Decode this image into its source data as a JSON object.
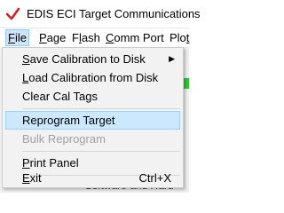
{
  "window": {
    "title": "EDIS ECI Target Communications",
    "icon": "checkmark-app-icon",
    "accent": "#d42020"
  },
  "menubar": {
    "file": {
      "pre": "",
      "u": "F",
      "post": "ile"
    },
    "page": {
      "pre": "",
      "u": "P",
      "post": "age"
    },
    "flash": {
      "pre": "F",
      "u": "l",
      "post": "ash"
    },
    "comm_port": {
      "pre": "",
      "u": "C",
      "post": "omm Port"
    },
    "plot": {
      "pre": "Plo",
      "u": "t",
      "post": ""
    }
  },
  "file_menu": {
    "save_cal": {
      "pre": "",
      "u": "S",
      "post": "ave Calibration to Disk"
    },
    "load_cal": {
      "pre": "",
      "u": "L",
      "post": "oad Calibration from Disk"
    },
    "clear_cal": {
      "pre": "Clear Cal Tags",
      "u": "",
      "post": ""
    },
    "reprogram": {
      "pre": "Reprogram Target",
      "u": "",
      "post": ""
    },
    "bulk_reprogram": {
      "pre": "Bulk Reprogram",
      "u": "",
      "post": ""
    },
    "print_panel": {
      "pre": "",
      "u": "P",
      "post": "rint Panel"
    },
    "exit": {
      "pre": "",
      "u": "E",
      "post": "xit",
      "shortcut": "Ctrl+X"
    }
  },
  "background": {
    "partial_text": "Software and Hard"
  },
  "colors": {
    "highlight": "#cce8ff",
    "status_green": "#2ec82e",
    "disabled_text": "#a0a0a0"
  }
}
